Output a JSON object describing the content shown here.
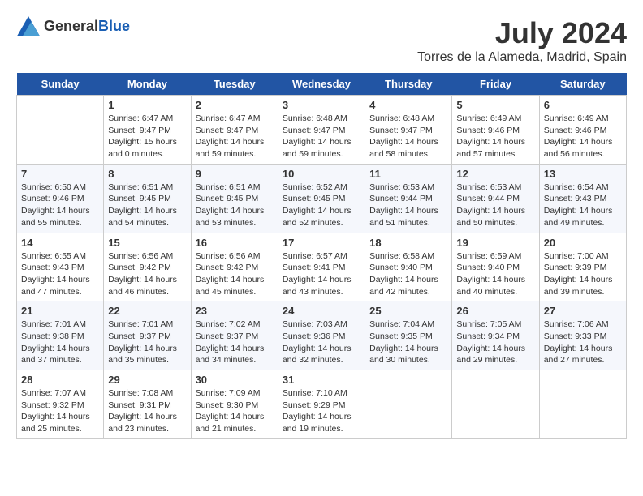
{
  "app": {
    "logo_general": "General",
    "logo_blue": "Blue"
  },
  "title": {
    "month": "July 2024",
    "location": "Torres de la Alameda, Madrid, Spain"
  },
  "headers": [
    "Sunday",
    "Monday",
    "Tuesday",
    "Wednesday",
    "Thursday",
    "Friday",
    "Saturday"
  ],
  "weeks": [
    [
      {
        "date": "",
        "sunrise": "",
        "sunset": "",
        "daylight": ""
      },
      {
        "date": "1",
        "sunrise": "Sunrise: 6:47 AM",
        "sunset": "Sunset: 9:47 PM",
        "daylight": "Daylight: 15 hours and 0 minutes."
      },
      {
        "date": "2",
        "sunrise": "Sunrise: 6:47 AM",
        "sunset": "Sunset: 9:47 PM",
        "daylight": "Daylight: 14 hours and 59 minutes."
      },
      {
        "date": "3",
        "sunrise": "Sunrise: 6:48 AM",
        "sunset": "Sunset: 9:47 PM",
        "daylight": "Daylight: 14 hours and 59 minutes."
      },
      {
        "date": "4",
        "sunrise": "Sunrise: 6:48 AM",
        "sunset": "Sunset: 9:47 PM",
        "daylight": "Daylight: 14 hours and 58 minutes."
      },
      {
        "date": "5",
        "sunrise": "Sunrise: 6:49 AM",
        "sunset": "Sunset: 9:46 PM",
        "daylight": "Daylight: 14 hours and 57 minutes."
      },
      {
        "date": "6",
        "sunrise": "Sunrise: 6:49 AM",
        "sunset": "Sunset: 9:46 PM",
        "daylight": "Daylight: 14 hours and 56 minutes."
      }
    ],
    [
      {
        "date": "7",
        "sunrise": "Sunrise: 6:50 AM",
        "sunset": "Sunset: 9:46 PM",
        "daylight": "Daylight: 14 hours and 55 minutes."
      },
      {
        "date": "8",
        "sunrise": "Sunrise: 6:51 AM",
        "sunset": "Sunset: 9:45 PM",
        "daylight": "Daylight: 14 hours and 54 minutes."
      },
      {
        "date": "9",
        "sunrise": "Sunrise: 6:51 AM",
        "sunset": "Sunset: 9:45 PM",
        "daylight": "Daylight: 14 hours and 53 minutes."
      },
      {
        "date": "10",
        "sunrise": "Sunrise: 6:52 AM",
        "sunset": "Sunset: 9:45 PM",
        "daylight": "Daylight: 14 hours and 52 minutes."
      },
      {
        "date": "11",
        "sunrise": "Sunrise: 6:53 AM",
        "sunset": "Sunset: 9:44 PM",
        "daylight": "Daylight: 14 hours and 51 minutes."
      },
      {
        "date": "12",
        "sunrise": "Sunrise: 6:53 AM",
        "sunset": "Sunset: 9:44 PM",
        "daylight": "Daylight: 14 hours and 50 minutes."
      },
      {
        "date": "13",
        "sunrise": "Sunrise: 6:54 AM",
        "sunset": "Sunset: 9:43 PM",
        "daylight": "Daylight: 14 hours and 49 minutes."
      }
    ],
    [
      {
        "date": "14",
        "sunrise": "Sunrise: 6:55 AM",
        "sunset": "Sunset: 9:43 PM",
        "daylight": "Daylight: 14 hours and 47 minutes."
      },
      {
        "date": "15",
        "sunrise": "Sunrise: 6:56 AM",
        "sunset": "Sunset: 9:42 PM",
        "daylight": "Daylight: 14 hours and 46 minutes."
      },
      {
        "date": "16",
        "sunrise": "Sunrise: 6:56 AM",
        "sunset": "Sunset: 9:42 PM",
        "daylight": "Daylight: 14 hours and 45 minutes."
      },
      {
        "date": "17",
        "sunrise": "Sunrise: 6:57 AM",
        "sunset": "Sunset: 9:41 PM",
        "daylight": "Daylight: 14 hours and 43 minutes."
      },
      {
        "date": "18",
        "sunrise": "Sunrise: 6:58 AM",
        "sunset": "Sunset: 9:40 PM",
        "daylight": "Daylight: 14 hours and 42 minutes."
      },
      {
        "date": "19",
        "sunrise": "Sunrise: 6:59 AM",
        "sunset": "Sunset: 9:40 PM",
        "daylight": "Daylight: 14 hours and 40 minutes."
      },
      {
        "date": "20",
        "sunrise": "Sunrise: 7:00 AM",
        "sunset": "Sunset: 9:39 PM",
        "daylight": "Daylight: 14 hours and 39 minutes."
      }
    ],
    [
      {
        "date": "21",
        "sunrise": "Sunrise: 7:01 AM",
        "sunset": "Sunset: 9:38 PM",
        "daylight": "Daylight: 14 hours and 37 minutes."
      },
      {
        "date": "22",
        "sunrise": "Sunrise: 7:01 AM",
        "sunset": "Sunset: 9:37 PM",
        "daylight": "Daylight: 14 hours and 35 minutes."
      },
      {
        "date": "23",
        "sunrise": "Sunrise: 7:02 AM",
        "sunset": "Sunset: 9:37 PM",
        "daylight": "Daylight: 14 hours and 34 minutes."
      },
      {
        "date": "24",
        "sunrise": "Sunrise: 7:03 AM",
        "sunset": "Sunset: 9:36 PM",
        "daylight": "Daylight: 14 hours and 32 minutes."
      },
      {
        "date": "25",
        "sunrise": "Sunrise: 7:04 AM",
        "sunset": "Sunset: 9:35 PM",
        "daylight": "Daylight: 14 hours and 30 minutes."
      },
      {
        "date": "26",
        "sunrise": "Sunrise: 7:05 AM",
        "sunset": "Sunset: 9:34 PM",
        "daylight": "Daylight: 14 hours and 29 minutes."
      },
      {
        "date": "27",
        "sunrise": "Sunrise: 7:06 AM",
        "sunset": "Sunset: 9:33 PM",
        "daylight": "Daylight: 14 hours and 27 minutes."
      }
    ],
    [
      {
        "date": "28",
        "sunrise": "Sunrise: 7:07 AM",
        "sunset": "Sunset: 9:32 PM",
        "daylight": "Daylight: 14 hours and 25 minutes."
      },
      {
        "date": "29",
        "sunrise": "Sunrise: 7:08 AM",
        "sunset": "Sunset: 9:31 PM",
        "daylight": "Daylight: 14 hours and 23 minutes."
      },
      {
        "date": "30",
        "sunrise": "Sunrise: 7:09 AM",
        "sunset": "Sunset: 9:30 PM",
        "daylight": "Daylight: 14 hours and 21 minutes."
      },
      {
        "date": "31",
        "sunrise": "Sunrise: 7:10 AM",
        "sunset": "Sunset: 9:29 PM",
        "daylight": "Daylight: 14 hours and 19 minutes."
      },
      {
        "date": "",
        "sunrise": "",
        "sunset": "",
        "daylight": ""
      },
      {
        "date": "",
        "sunrise": "",
        "sunset": "",
        "daylight": ""
      },
      {
        "date": "",
        "sunrise": "",
        "sunset": "",
        "daylight": ""
      }
    ]
  ]
}
